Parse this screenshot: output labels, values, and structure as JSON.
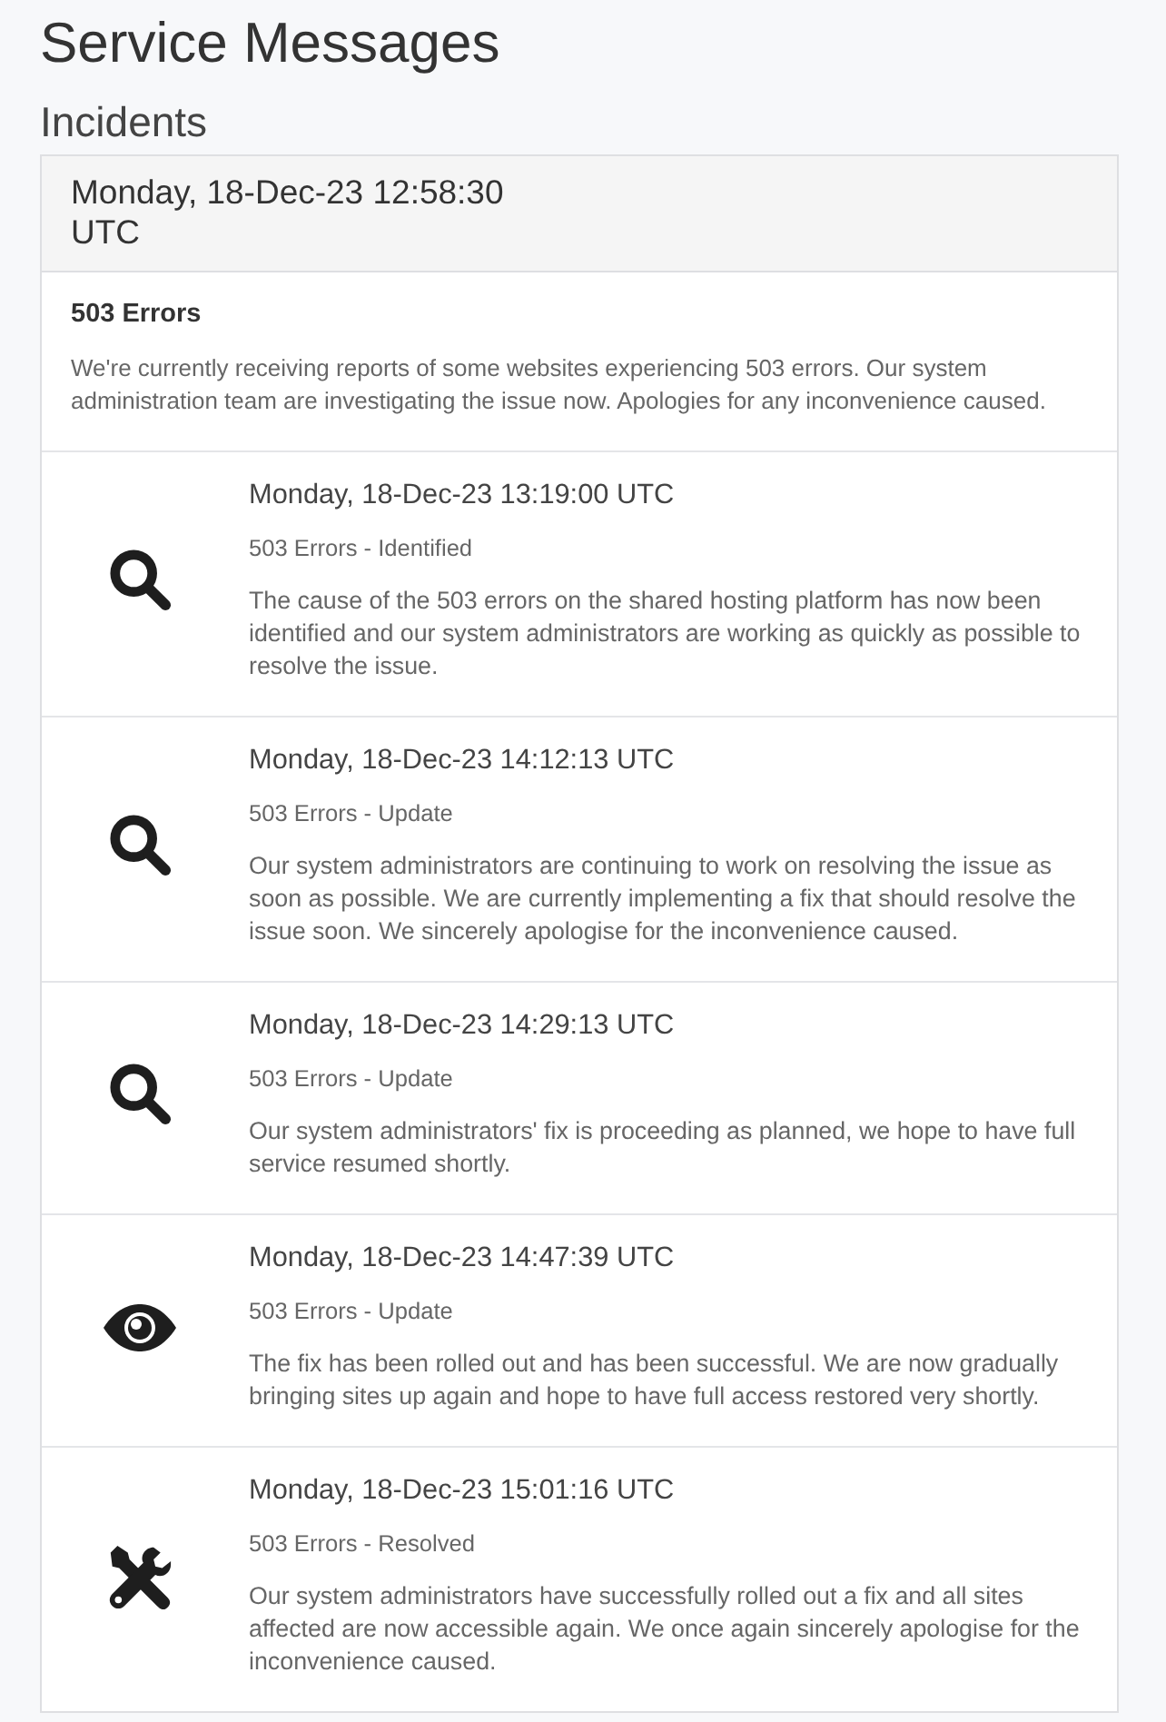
{
  "page": {
    "title": "Service Messages",
    "section_title": "Incidents"
  },
  "incident": {
    "header": "Monday, 18-Dec-23 12:58:30 UTC",
    "title": "503 Errors",
    "description": "We're currently receiving reports of some websites experiencing 503 errors. Our system administration team are investigating the issue now. Apologies for any inconvenience caused."
  },
  "updates": [
    {
      "kind": "search",
      "time": "Monday, 18-Dec-23 13:19:00 UTC",
      "status": "503 Errors - Identified",
      "message": "The cause of the 503 errors on the shared hosting platform has now been identified and our system administrators are working as quickly as possible to resolve the issue."
    },
    {
      "kind": "search",
      "time": "Monday, 18-Dec-23 14:12:13 UTC",
      "status": "503 Errors - Update",
      "message": "Our system administrators are continuing to work on resolving the issue as soon as possible. We are currently implementing a fix that should resolve the issue soon. We sincerely apologise for the inconvenience caused."
    },
    {
      "kind": "search",
      "time": "Monday, 18-Dec-23 14:29:13 UTC",
      "status": "503 Errors - Update",
      "message": "Our system administrators' fix is proceeding as planned, we hope to have full service resumed shortly."
    },
    {
      "kind": "eye",
      "time": "Monday, 18-Dec-23 14:47:39 UTC",
      "status": "503 Errors - Update",
      "message": "The fix has been rolled out and has been successful. We are now gradually bringing sites up again and hope to have full access restored very shortly."
    },
    {
      "kind": "tools",
      "time": "Monday, 18-Dec-23 15:01:16 UTC",
      "status": "503 Errors - Resolved",
      "message": "Our system administrators have successfully rolled out a fix and all sites affected are now accessible again. We once again sincerely apologise for the inconvenience caused."
    }
  ]
}
